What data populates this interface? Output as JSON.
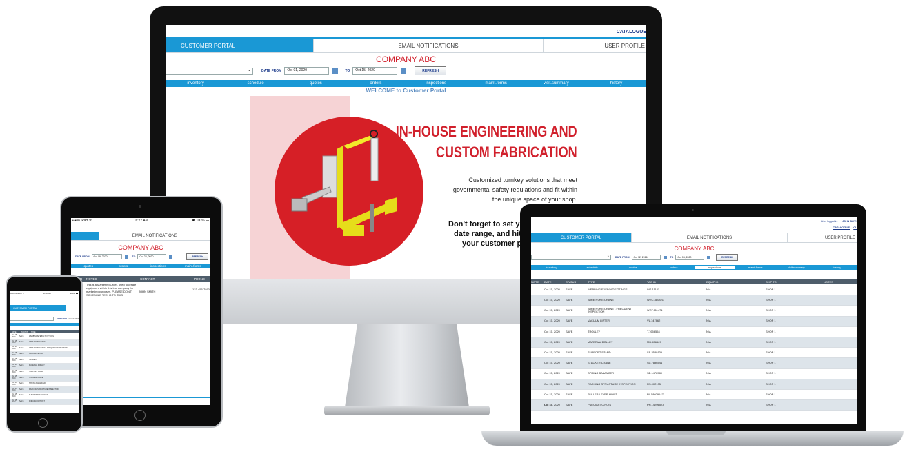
{
  "desktop": {
    "top_link": "CATALOGUE",
    "tabs": [
      "CUSTOMER PORTAL",
      "EMAIL NOTIFICATIONS",
      "USER PROFILE"
    ],
    "company": "COMPANY ABC",
    "date_from_label": "DATE FROM",
    "date_from": "Oct 01, 2020",
    "to_label": "TO",
    "date_to": "Oct 15, 2020",
    "refresh": "REFRESH",
    "nav": [
      "inventory",
      "schedule",
      "quotes",
      "orders",
      "inspections",
      "maint.forms",
      "visit.summary",
      "history"
    ],
    "welcome": "WELCOME to Customer Portal",
    "headline_1": "IN-HOUSE ENGINEERING AND",
    "headline_2": "CUSTOM FABRICATION",
    "body_1": "Customized turnkey solutions that meet",
    "body_2": "governmental safety regulations and fit within",
    "body_3": "the unique space of your shop.",
    "note_1": "Don't forget to set yo",
    "note_2": "date range, and hit",
    "note_3": "your customer po"
  },
  "tablet": {
    "status_left": "•••oo iPad ᯤ",
    "time": "6:27 AM",
    "status_right": "✱ 100% ▬",
    "tab": "EMAIL NOTIFICATIONS",
    "company": "COMPANY ABC",
    "date_from_label": "DATE FROM",
    "date_from": "Oct 09, 2020",
    "to_label": "TO",
    "date_to": "Oct 23, 2020",
    "refresh": "REFRESH",
    "nav": [
      "quotes",
      "orders",
      "inspections",
      "maint.forms"
    ],
    "columns": [
      "ORDER",
      "NOTES",
      "CONTACT",
      "PHONE"
    ],
    "row": {
      "notes": "This is a Marketing Order, used to create equipment within this test company for marketing purposes. PLEASE DON'T SCHEDULE TECHS TO THIS.",
      "contact": "JOHN SMITH",
      "phone": "123-456-7890"
    }
  },
  "phone": {
    "status_left": "•••oo iPhone ᯤ",
    "time": "9:48 AM",
    "status_right": "100% ▬",
    "tab": "CUSTOMER PORTAL",
    "date_from_label": "DATE FROM",
    "date_from": "Oct 12, 2016",
    "columns": [
      "DATE",
      "STATUS",
      "TYPE"
    ],
    "rows": [
      [
        "Oct 15, 2020",
        "SAFE",
        "WEBBING/EYEBOLT/FITTINGS"
      ],
      [
        "Oct 15, 2020",
        "SAFE",
        "WIRE ROPE CRANE"
      ],
      [
        "Oct 15, 2020",
        "SAFE",
        "WIRE ROPE CRANE - FREQUENT INSPECTION"
      ],
      [
        "Oct 15, 2020",
        "SAFE",
        "VACUUM LIFTER"
      ],
      [
        "Oct 15, 2020",
        "SAFE",
        "TROLLEY"
      ],
      [
        "Oct 15, 2020",
        "SAFE",
        "MATERIAL DOLLEY"
      ],
      [
        "Oct 15, 2020",
        "SAFE",
        "SUPPORT STAND"
      ],
      [
        "Oct 15, 2020",
        "SAFE",
        "STACKER CRANE"
      ],
      [
        "Oct 15, 2020",
        "SAFE",
        "SPRING BALANCER"
      ],
      [
        "Oct 15, 2020",
        "SAFE",
        "RACKING STRUCTURE INSPECTION"
      ],
      [
        "Oct 15, 2020",
        "SAFE",
        "PULLER/LEVER HOIST"
      ],
      [
        "Oct 15, 2020",
        "SAFE",
        "PNEUMATIC HOIST"
      ]
    ]
  },
  "laptop": {
    "user_logged_label": "User logged in:",
    "user_name": "JOHN SMITH",
    "links": [
      "CATALOGUE",
      "CU"
    ],
    "tabs": [
      "CUSTOMER PORTAL",
      "EMAIL NOTIFICATIONS",
      "USER PROFILE"
    ],
    "company": "COMPANY ABC",
    "date_from_label": "DATE FROM",
    "date_from": "Oct 12, 2016",
    "to_label": "TO",
    "date_to": "Oct 03, 2020",
    "refresh": "REFRESH",
    "nav": [
      "inventory",
      "schedule",
      "quotes",
      "orders",
      "inspections",
      "maint.forms",
      "visit.summary",
      "history"
    ],
    "columns": [
      "NOTE",
      "DATE",
      "STATUS",
      "TYPE",
      "TAG ID",
      "EQUIP ID",
      "SHIP TO",
      "NOTES"
    ],
    "rows": [
      [
        "Oct 15, 2020",
        "SAFE",
        "WEBBING/EYEBOLT/FITTINGS",
        "WS.11141",
        "N/A",
        "SHOP 1"
      ],
      [
        "Oct 15, 2020",
        "SAFE",
        "WIRE ROPE CRANE",
        "WRC.880821",
        "N/A",
        "SHOP 1"
      ],
      [
        "Oct 15, 2020",
        "SAFE",
        "WIRE ROPE CRANE - FREQUENT INSPECTION",
        "WRF.111471",
        "N/A",
        "SHOP 1"
      ],
      [
        "Oct 15, 2020",
        "SAFE",
        "VACUUM LIFTER",
        "VL.147862",
        "N/A",
        "SHOP 1"
      ],
      [
        "Oct 15, 2020",
        "SAFE",
        "TROLLEY",
        "T.7656554",
        "N/A",
        "SHOP 1"
      ],
      [
        "Oct 15, 2020",
        "SAFE",
        "MATERIAL DOLLEY",
        "MD.456667",
        "N/A",
        "SHOP 1"
      ],
      [
        "Oct 15, 2020",
        "SAFE",
        "SUPPORT STAND",
        "SS.2580139",
        "N/A",
        "SHOP 1"
      ],
      [
        "Oct 15, 2020",
        "SAFE",
        "STACKER CRANE",
        "SC.7836541",
        "N/A",
        "SHOP 1"
      ],
      [
        "Oct 15, 2020",
        "SAFE",
        "SPRING BALANCER",
        "SB.1472580",
        "N/A",
        "SHOP 1"
      ],
      [
        "Oct 15, 2020",
        "SAFE",
        "RACKING STRUCTURE INSPECTION",
        "RS.002135",
        "N/A",
        "SHOP 1"
      ],
      [
        "Oct 15, 2020",
        "SAFE",
        "PULLER/LEVER HOIST",
        "PL.58029147",
        "N/A",
        "SHOP 1"
      ],
      [
        "Oct 15, 2020",
        "SAFE",
        "PNEUMATIC HOIST",
        "PH.14706523",
        "N/A",
        "SHOP 1"
      ]
    ],
    "partial_row_date": "Oct 15,"
  },
  "colors": {
    "brand_blue": "#1a98d5",
    "company_red": "#d1202c",
    "hero_circle": "#d61f26",
    "device_black": "#111111"
  }
}
